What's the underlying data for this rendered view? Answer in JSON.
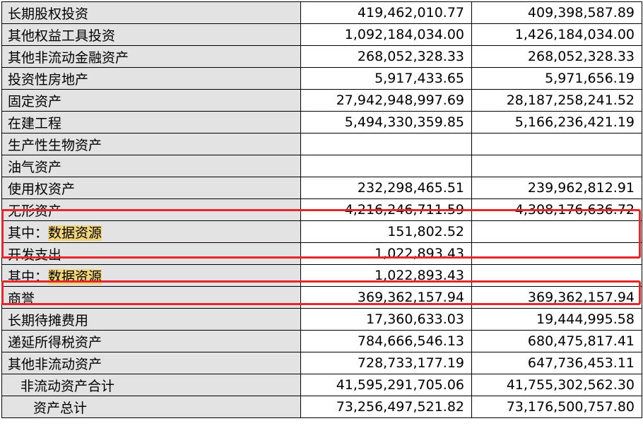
{
  "rows": [
    {
      "label": "长期股权投资",
      "v1": "419,462,010.77",
      "v2": "409,398,587.89"
    },
    {
      "label": "其他权益工具投资",
      "v1": "1,092,184,034.00",
      "v2": "1,426,184,034.00"
    },
    {
      "label": "其他非流动金融资产",
      "v1": "268,052,328.33",
      "v2": "268,052,328.33"
    },
    {
      "label": "投资性房地产",
      "v1": "5,917,433.65",
      "v2": "5,971,656.19"
    },
    {
      "label": "固定资产",
      "v1": "27,942,948,997.69",
      "v2": "28,187,258,241.52"
    },
    {
      "label": "在建工程",
      "v1": "5,494,330,359.85",
      "v2": "5,166,236,421.19"
    },
    {
      "label": "生产性生物资产",
      "v1": "",
      "v2": ""
    },
    {
      "label": "油气资产",
      "v1": "",
      "v2": ""
    },
    {
      "label": "使用权资产",
      "v1": "232,298,465.51",
      "v2": "239,962,812.91"
    },
    {
      "label": "无形资产",
      "v1": "4,216,246,711.59",
      "v2": "4,308,176,636.72"
    },
    {
      "label_prefix": "其中：",
      "label_hl": "数据资源",
      "v1": "151,802.52",
      "v2": ""
    },
    {
      "label": "开发支出",
      "v1": "1,022,893.43",
      "v2": ""
    },
    {
      "label_prefix": "其中：",
      "label_hl": "数据资源",
      "v1": "1,022,893.43",
      "v2": ""
    },
    {
      "label": "商誉",
      "v1": "369,362,157.94",
      "v2": "369,362,157.94"
    },
    {
      "label": "长期待摊费用",
      "v1": "17,360,633.03",
      "v2": "19,444,995.58"
    },
    {
      "label": "递延所得税资产",
      "v1": "784,666,546.13",
      "v2": "680,475,817.41"
    },
    {
      "label": "其他非流动资产",
      "v1": "728,733,177.19",
      "v2": "647,736,453.11"
    },
    {
      "label": "非流动资产合计",
      "v1": "41,595,291,705.06",
      "v2": "41,755,302,562.30"
    },
    {
      "label": "资产总计",
      "v1": "73,256,497,521.82",
      "v2": "73,176,500,757.80"
    }
  ],
  "highlight_color": "#f2d57a",
  "box_color": "#e8262a"
}
